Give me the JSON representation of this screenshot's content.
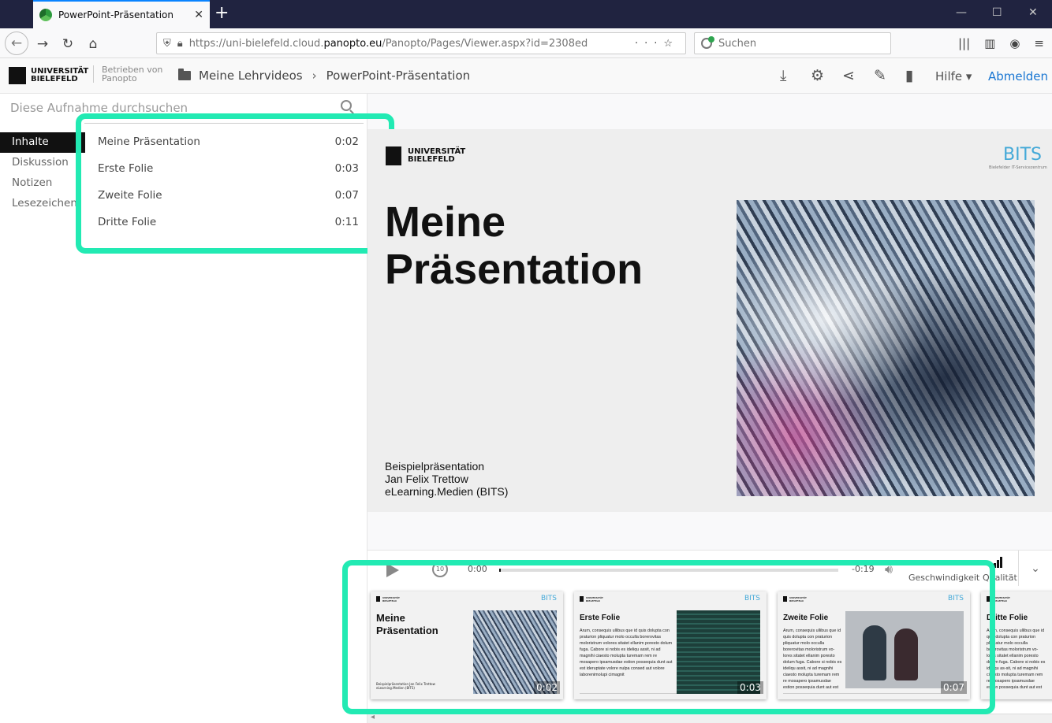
{
  "browser": {
    "tab_title": "PowerPoint-Präsentation",
    "tab_close": "✕",
    "new_tab": "+",
    "url_prefix": "https://uni-bielefeld.cloud.",
    "url_domain": "panopto.eu",
    "url_path": "/Panopto/Pages/Viewer.aspx?id=2308ed",
    "search_placeholder": "Suchen"
  },
  "header": {
    "logo_line1": "UNIVERSITÄT",
    "logo_line2": "BIELEFELD",
    "powered_line1": "Betrieben von",
    "powered_line2": "Panopto",
    "breadcrumb_folder": "Meine Lehrvideos",
    "breadcrumb_sep": "›",
    "breadcrumb_current": "PowerPoint-Präsentation",
    "help": "Hilfe ▾",
    "logout": "Abmelden"
  },
  "sidebar": {
    "search_placeholder": "Diese Aufnahme durchsuchen",
    "nav": [
      "Inhalte",
      "Diskussion",
      "Notizen",
      "Lesezeichen"
    ],
    "toc": [
      {
        "title": "Meine Präsentation",
        "time": "0:02"
      },
      {
        "title": "Erste Folie",
        "time": "0:03"
      },
      {
        "title": "Zweite Folie",
        "time": "0:07"
      },
      {
        "title": "Dritte Folie",
        "time": "0:11"
      }
    ]
  },
  "slide": {
    "logo_line1": "UNIVERSITÄT",
    "logo_line2": "BIELEFELD",
    "bits": "BITS",
    "bits_tag": "Bielefelder IT-Servicezentrum",
    "title_line1": "Meine",
    "title_line2": "Präsentation",
    "info_line1": "Beispielpräsentation",
    "info_line2": "Jan Felix Trettow",
    "info_line3": "eLearning.Medien  (BITS)"
  },
  "player": {
    "time_elapsed": "0:00",
    "time_remaining": "-0:19",
    "progress_fraction": 0.0,
    "rewind_label": "10",
    "speed_label": "Geschwindigkeit",
    "quality_label": "Qualität"
  },
  "thumbnails": [
    {
      "title_line1": "Meine",
      "title_line2": "Präsentation",
      "duration": "0:02",
      "info": "Beispielpräsentation Jan Felix Trettow eLearning.Medien (BITS)"
    },
    {
      "title_line1": "Erste Folie",
      "title_line2": "",
      "duration": "0:03",
      "body": "Arum, consequis ullibus que id quis dolupta con praturion pliquatur molo occulla borerovitas moloristrum volores sitatet ellanim poresto dolum fuga. Cabore si nobis es ideliqu assit, ni ad magnihi ciaesto molupta turemam rem re mosapero ipsamusdae estion possequia dunt aut est ideruptate volore nulpa consed aut volore laborenimolupi cimagnit"
    },
    {
      "title_line1": "Zweite Folie",
      "title_line2": "",
      "duration": "0:07",
      "body": "Arum, consequis ullibus que id quis dolupta con praturion pliquatur molo occulla borerovitas moloristrum vo-lores sitatet ellanim poresto dolum fuga. Cabore si nobis es ideliqu assit, ni ad magnihi ciaesto molupta turemam rem re mosapero ipsamusdae estion possequia dunt aut est"
    },
    {
      "title_line1": "Dritte Folie",
      "title_line2": "",
      "duration": "",
      "body": "Arum, consequis ullibus que id quis dolupta con praturion pliquatur molo occulla borerovitas moloristrum vo-lores sitatet ellanim poresto dolum fuga. Cabore si nobis es ideliqu as-sit, ni ad magnihi ciaesto molupta turemam rem re mosapero ipsamusdae estion possequia dunt aut est"
    }
  ],
  "colors": {
    "highlight": "#22eab3",
    "link": "#1976d2",
    "tabstrip": "#202340"
  }
}
